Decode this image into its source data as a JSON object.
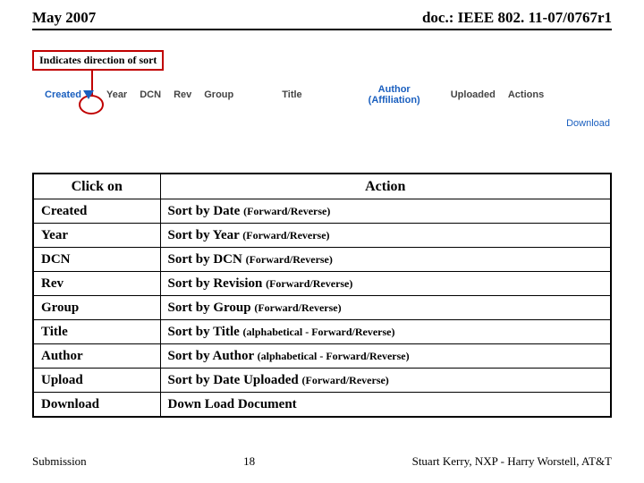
{
  "header": {
    "date": "May 2007",
    "docref": "doc.: IEEE 802. 11-07/0767r1"
  },
  "callout": {
    "text": "Indicates direction of sort"
  },
  "columns": {
    "created": "Created",
    "year": "Year",
    "dcn": "DCN",
    "rev": "Rev",
    "group": "Group",
    "title": "Title",
    "author_line1": "Author",
    "author_line2": "(Affiliation)",
    "uploaded": "Uploaded",
    "actions": "Actions",
    "download": "Download"
  },
  "table": {
    "head": {
      "clickon": "Click on",
      "action": "Action"
    },
    "rows": [
      {
        "c": "Created",
        "a": "Sort by Date ",
        "s": "(Forward/Reverse)"
      },
      {
        "c": "Year",
        "a": "Sort by Year ",
        "s": "(Forward/Reverse)"
      },
      {
        "c": "DCN",
        "a": "Sort by DCN ",
        "s": "(Forward/Reverse)"
      },
      {
        "c": "Rev",
        "a": "Sort by Revision ",
        "s": "(Forward/Reverse)"
      },
      {
        "c": "Group",
        "a": "Sort by Group ",
        "s": "(Forward/Reverse)"
      },
      {
        "c": "Title",
        "a": "Sort by Title ",
        "s": "(alphabetical - Forward/Reverse)"
      },
      {
        "c": "Author",
        "a": "Sort by Author ",
        "s": "(alphabetical - Forward/Reverse)"
      },
      {
        "c": "Upload",
        "a": "Sort by Date Uploaded ",
        "s": "(Forward/Reverse)"
      },
      {
        "c": "Download",
        "a": "Down Load Document",
        "s": ""
      }
    ]
  },
  "footer": {
    "left": "Submission",
    "page": "18",
    "right": "Stuart Kerry, NXP - Harry Worstell, AT&T"
  }
}
